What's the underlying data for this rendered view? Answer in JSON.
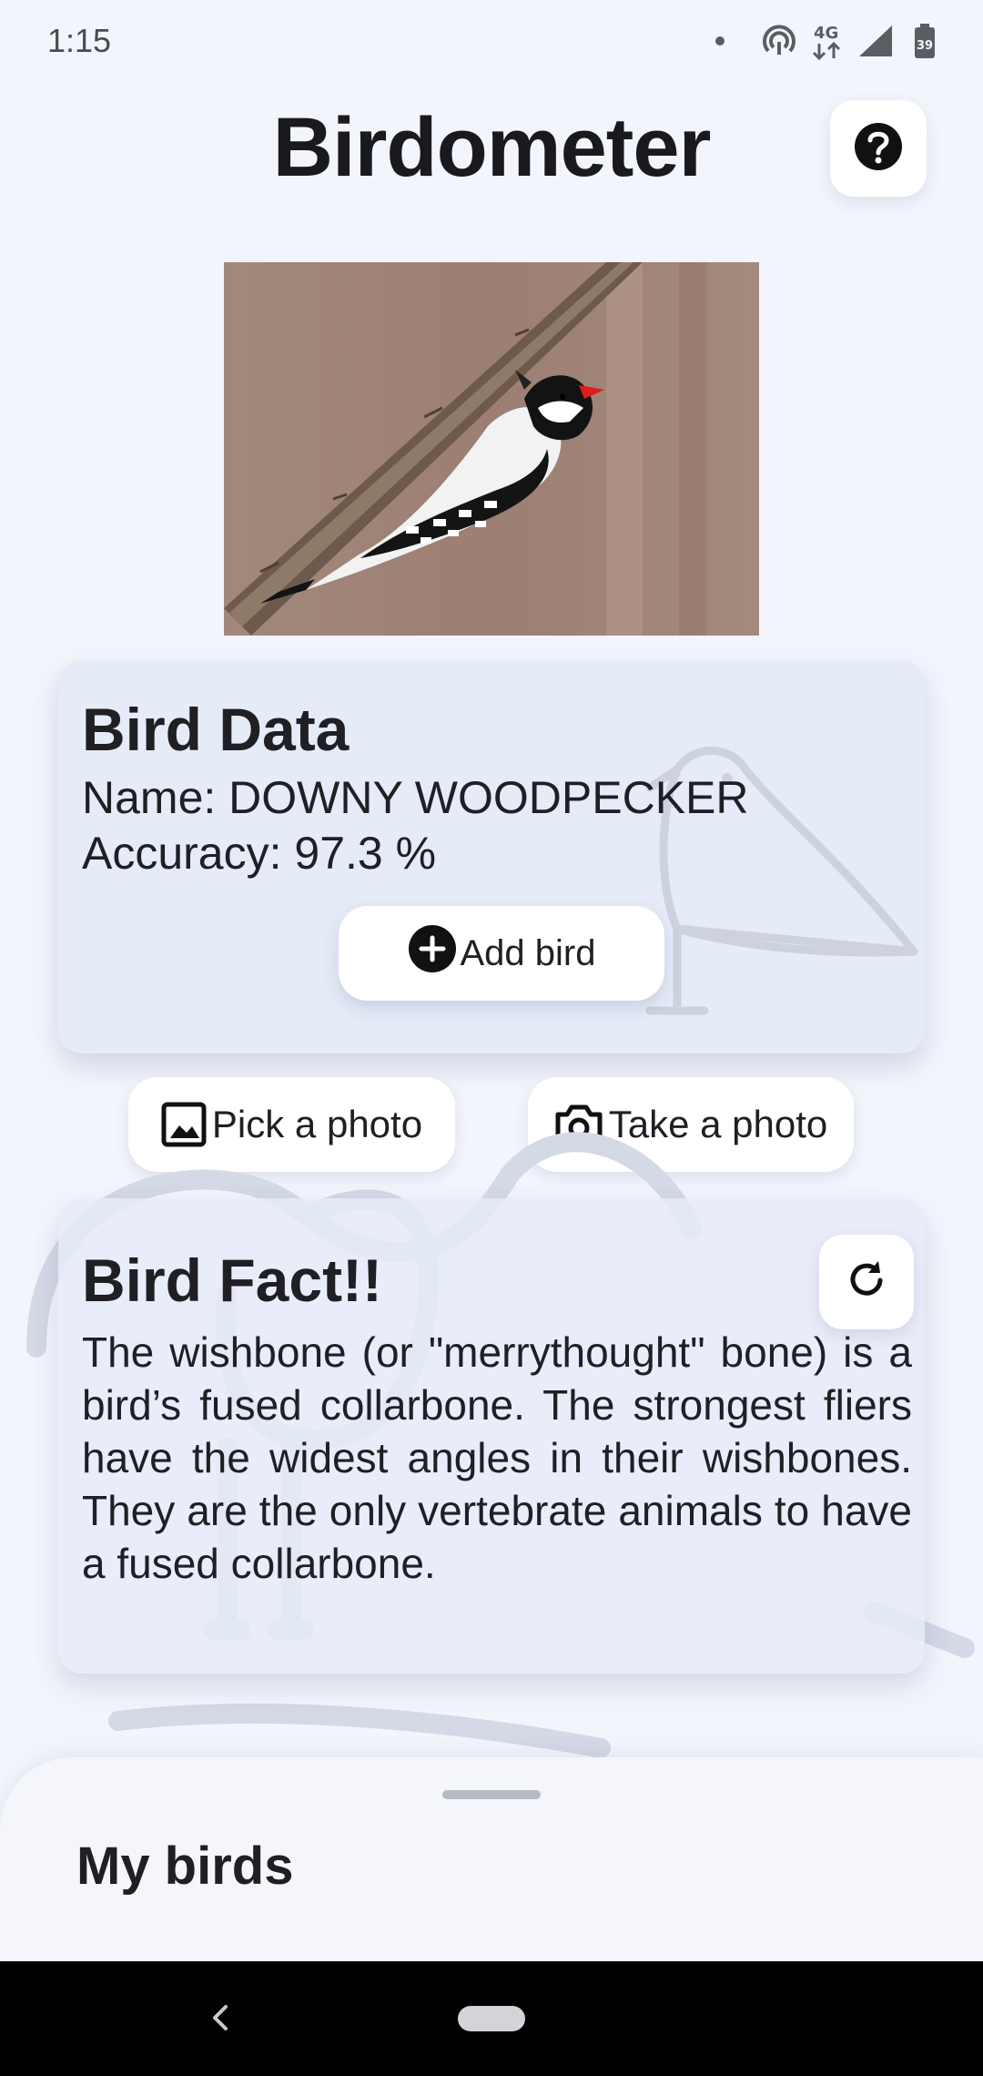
{
  "status_bar": {
    "time": "1:15",
    "icons": [
      "notification-dot-icon",
      "hotspot-icon",
      "network-4g-icon",
      "signal-icon",
      "battery-icon"
    ],
    "network_label": "4G",
    "battery_level": "39"
  },
  "header": {
    "title": "Birdometer",
    "help_icon": "help-circle-icon"
  },
  "bird_data": {
    "title": "Bird Data",
    "name_label": "Name:",
    "name_value": "DOWNY WOODPECKER",
    "accuracy_label": "Accuracy:",
    "accuracy_value": "97.3 %",
    "add_button_label": "Add bird",
    "add_button_icon": "add-circle-icon",
    "watermark_icon": "bird-outline-icon"
  },
  "photo_actions": {
    "pick_label": "Pick a photo",
    "pick_icon": "image-icon",
    "take_label": "Take a photo",
    "take_icon": "camera-icon"
  },
  "bird_fact": {
    "title": "Bird Fact!!",
    "text": "The wishbone (or \"merrythought\" bone) is a bird’s fused collarbone. The strongest fliers have the widest angles in their wishbones. They are the only vertebrate animals to have a fused collarbone.",
    "refresh_icon": "refresh-icon"
  },
  "bottom_sheet": {
    "title": "My birds"
  },
  "colors": {
    "background": "#f3f5fc",
    "card": "#e6ebf8",
    "button": "#ffffff",
    "text": "#1f1f24",
    "woodpecker_red": "#e01b1b"
  }
}
